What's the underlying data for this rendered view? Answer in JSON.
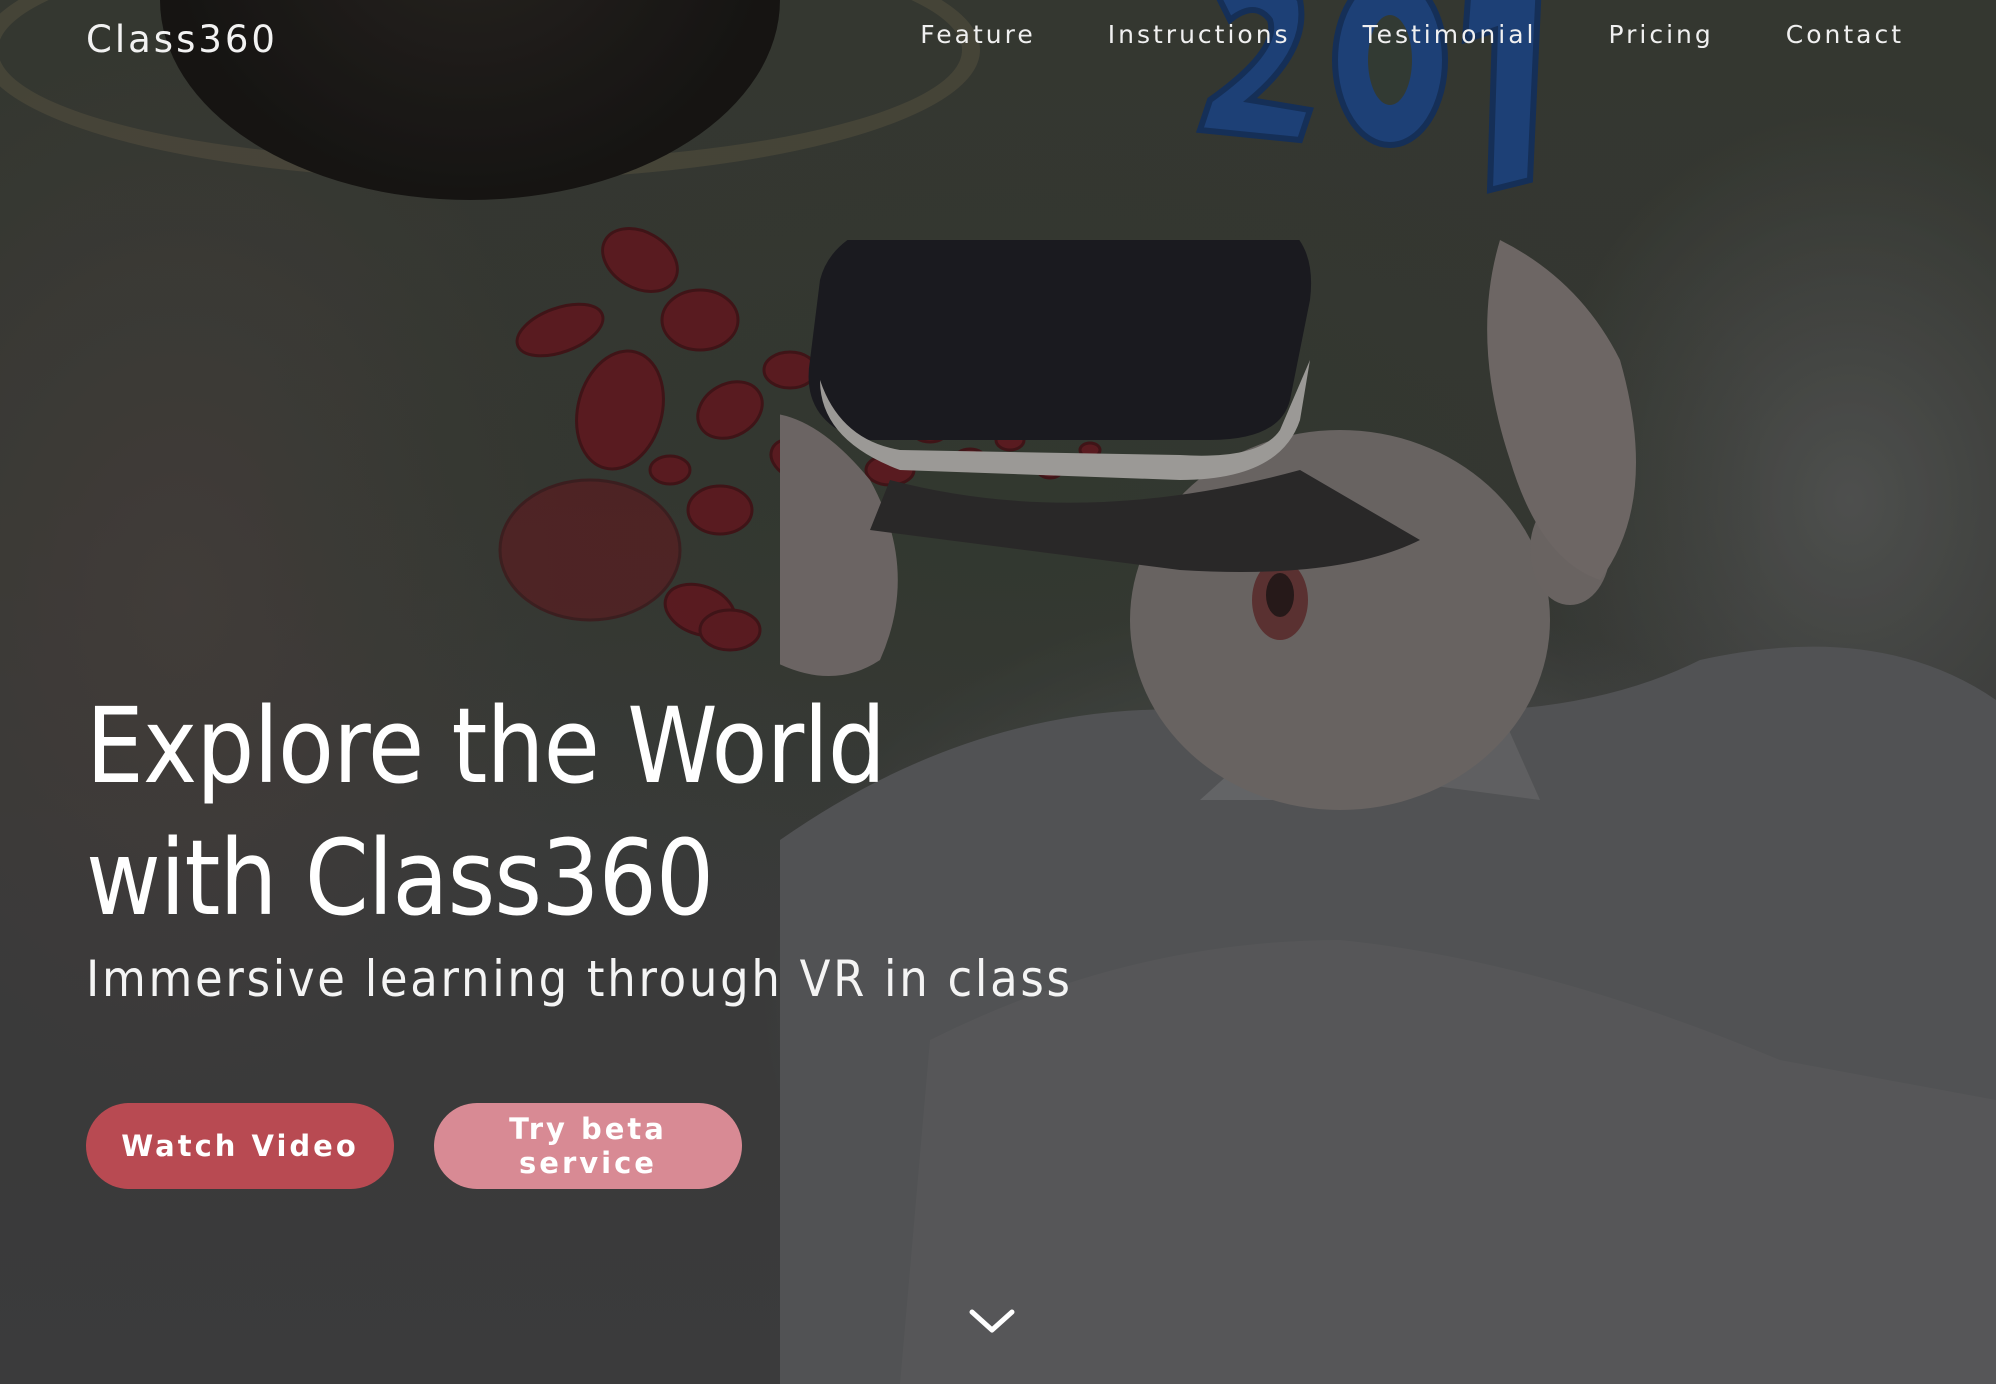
{
  "navbar": {
    "brand": "Class360",
    "links": [
      {
        "label": "Feature"
      },
      {
        "label": "Instructions"
      },
      {
        "label": "Testimonial"
      },
      {
        "label": "Pricing"
      },
      {
        "label": "Contact"
      }
    ]
  },
  "hero": {
    "headline_line1": "Explore the World",
    "headline_line2": "with Class360",
    "subheadline": "Immersive learning through VR in class",
    "primary_button": "Watch Video",
    "secondary_button": "Try beta service",
    "scroll_icon": "chevron-down-icon"
  },
  "colors": {
    "primary_button": "#b84a52",
    "secondary_button": "#d88a94",
    "text": "#ffffff"
  }
}
